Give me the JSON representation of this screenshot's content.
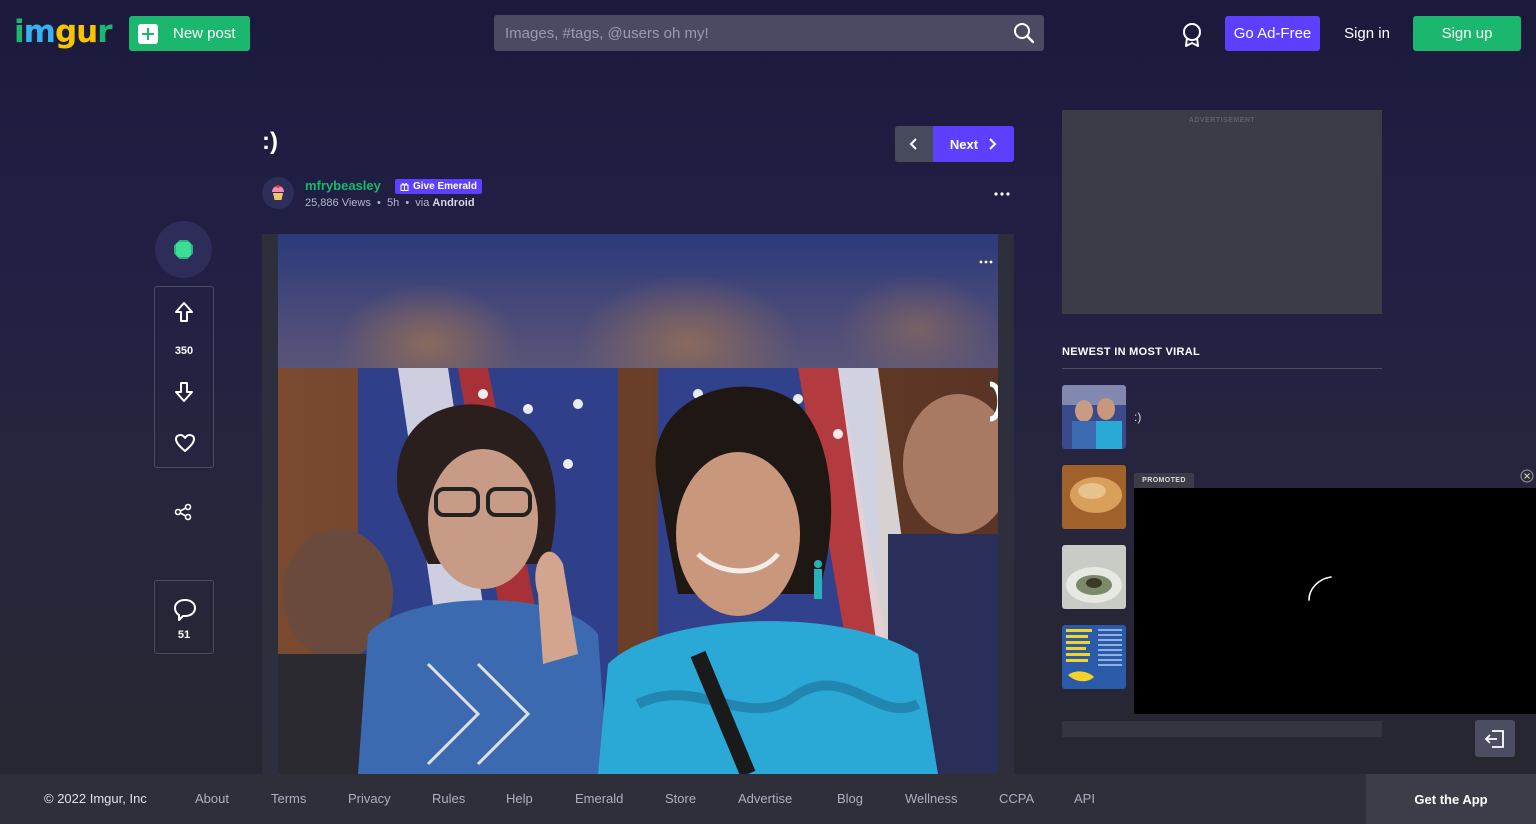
{
  "header": {
    "logo_text": "imgur",
    "new_post_label": "New post",
    "search_placeholder": "Images, #tags, @users oh my!",
    "go_adfree_label": "Go Ad-Free",
    "sign_in_label": "Sign in",
    "sign_up_label": "Sign up"
  },
  "post": {
    "title": ":)",
    "next_label": "Next",
    "username": "mfrybeasley",
    "give_emerald_label": "Give Emerald",
    "views": "25,886 Views",
    "time": "5h",
    "via_label": "via",
    "via_platform": "Android",
    "upvotes": "350",
    "comments": "51"
  },
  "sidebar": {
    "ad_label": "ADVERTISEMENT",
    "newest_heading": "NEWEST IN MOST VIRAL",
    "viral_items": [
      {
        "title": ":)"
      },
      {
        "title": ""
      },
      {
        "title": ""
      },
      {
        "title": ""
      }
    ],
    "promoted_label": "PROMOTED"
  },
  "footer": {
    "copyright": "© 2022 Imgur, Inc",
    "links": [
      "About",
      "Terms",
      "Privacy",
      "Rules",
      "Help",
      "Emerald",
      "Store",
      "Advertise",
      "Blog",
      "Wellness",
      "CCPA",
      "API"
    ],
    "get_app_label": "Get the App"
  },
  "colors": {
    "brand_green": "#1bb76e",
    "brand_purple": "#5c3fff",
    "background": "#1b1a3b"
  }
}
